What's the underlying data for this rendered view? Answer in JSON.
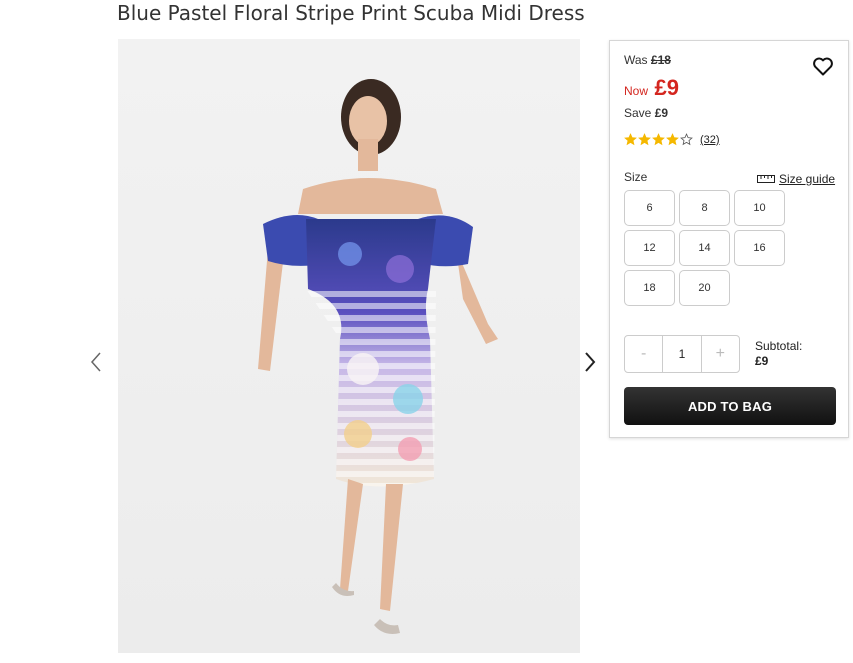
{
  "product": {
    "title": "Blue Pastel Floral Stripe Print Scuba Midi Dress",
    "image_alt": "Model wearing blue pastel floral stripe print scuba midi dress"
  },
  "pricing": {
    "was_label": "Was",
    "was_price": "£18",
    "now_label": "Now",
    "now_price": "£9",
    "save_label": "Save",
    "save_amount": "£9"
  },
  "rating": {
    "stars": 4,
    "out_of": 5,
    "reviews_text": "(32)"
  },
  "size": {
    "label": "Size",
    "guide_label": "Size guide",
    "options": [
      "6",
      "8",
      "10",
      "12",
      "14",
      "16",
      "18",
      "20"
    ]
  },
  "quantity": {
    "minus": "-",
    "value": "1",
    "plus": "+"
  },
  "subtotal": {
    "label": "Subtotal:",
    "amount": "£9"
  },
  "add_to_bag_label": "ADD TO BAG",
  "colors": {
    "sale_red": "#d4261f",
    "star_gold": "#f5b800",
    "button_dark": "#1a1a1a"
  },
  "icons": {
    "wishlist": "heart-outline-icon",
    "size_guide": "ruler-icon",
    "prev": "chevron-left-icon",
    "next": "chevron-right-icon"
  }
}
